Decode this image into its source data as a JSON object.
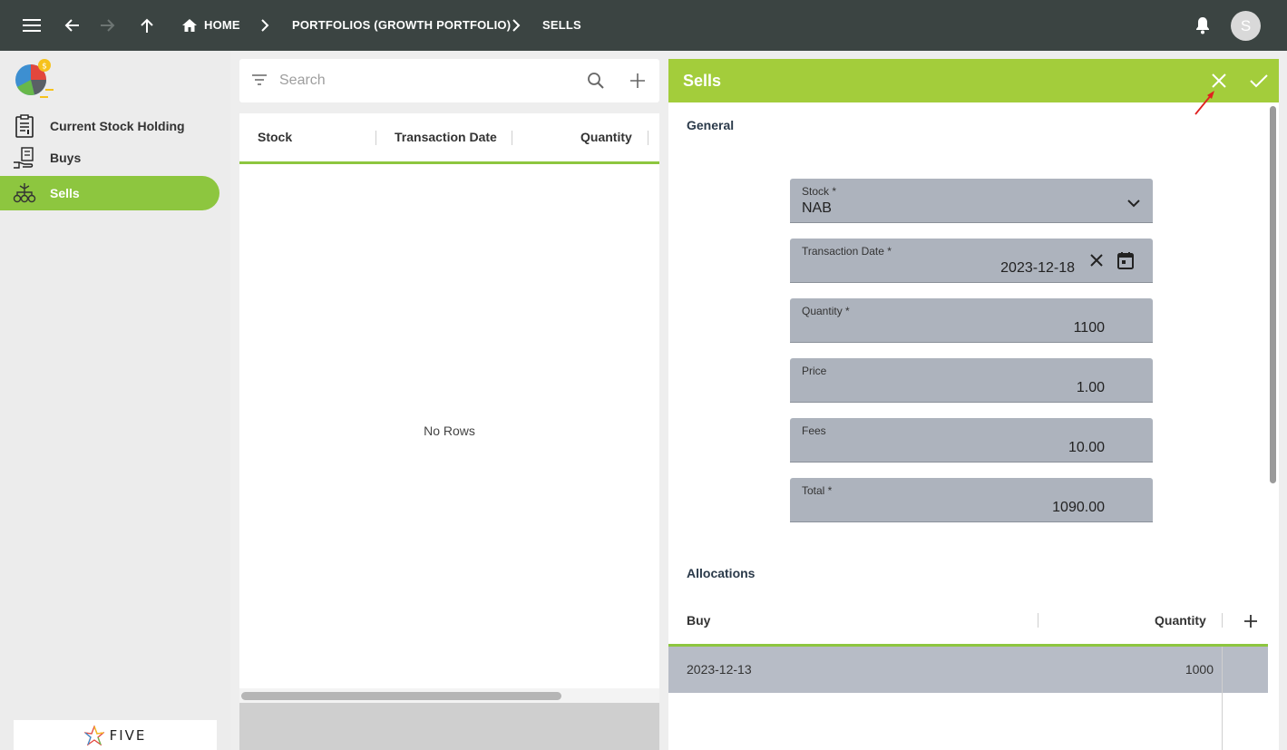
{
  "topbar": {
    "menu_icon": "hamburger-menu-icon",
    "back_icon": "arrow-left-icon",
    "forward_icon": "arrow-right-icon",
    "up_icon": "arrow-up-icon",
    "home_label": "HOME",
    "crumb_portfolio": "PORTFOLIOS (GROWTH PORTFOLIO)",
    "crumb_sells": "SELLS",
    "bell_icon": "bell-icon",
    "avatar_letter": "S"
  },
  "sidebar": {
    "items": [
      {
        "label": "Current Stock Holding",
        "icon": "clipboard-chart-icon"
      },
      {
        "label": "Buys",
        "icon": "hand-money-icon"
      },
      {
        "label": "Sells",
        "icon": "money-tree-icon"
      }
    ],
    "footer_logo": "FIVE"
  },
  "list": {
    "search_placeholder": "Search",
    "columns": [
      "Stock",
      "Transaction Date",
      "Quantity"
    ],
    "empty_text": "No Rows"
  },
  "form": {
    "title": "Sells",
    "section_general": "General",
    "fields": {
      "stock": {
        "label": "Stock *",
        "value": "NAB"
      },
      "transaction_date": {
        "label": "Transaction Date *",
        "value": "2023-12-18"
      },
      "quantity": {
        "label": "Quantity *",
        "value": "1100"
      },
      "price": {
        "label": "Price",
        "value": "1.00"
      },
      "fees": {
        "label": "Fees",
        "value": "10.00"
      },
      "total": {
        "label": "Total *",
        "value": "1090.00"
      }
    },
    "section_allocations": "Allocations",
    "alloc_columns": {
      "buy": "Buy",
      "quantity": "Quantity"
    },
    "alloc_rows": [
      {
        "buy": "2023-12-13",
        "quantity": "1000"
      }
    ]
  },
  "colors": {
    "topbar": "#3b4442",
    "accent_green": "#8dc63f",
    "form_header": "#a3cd3b",
    "field_bg": "#adb3bd",
    "annotation_arrow": "#e02020"
  }
}
